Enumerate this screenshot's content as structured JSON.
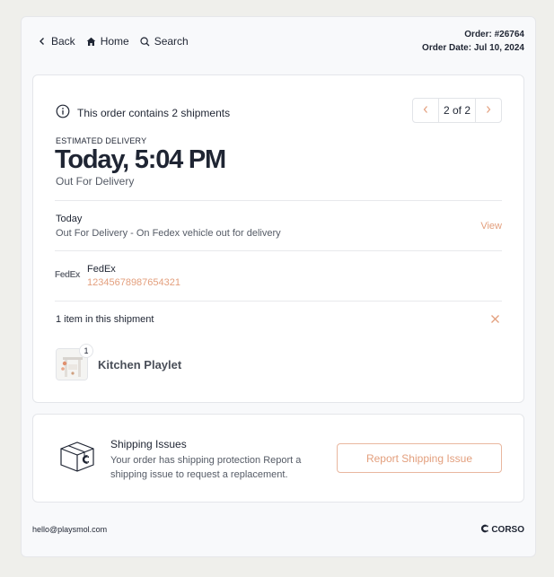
{
  "nav": {
    "back_label": "Back",
    "home_label": "Home",
    "search_label": "Search"
  },
  "order": {
    "number": "Order: #26764",
    "date": "Order Date: Jul 10, 2024"
  },
  "shipments": {
    "summary": "This order contains 2 shipments",
    "pager": "2 of 2"
  },
  "delivery": {
    "label": "ESTIMATED DELIVERY",
    "time": "Today, 5:04 PM",
    "status": "Out For Delivery"
  },
  "update": {
    "day": "Today",
    "text": "Out For Delivery - On Fedex vehicle out for delivery",
    "view_label": "View"
  },
  "carrier": {
    "logo_text": "FedEx",
    "name": "FedEx",
    "tracking": "12345678987654321"
  },
  "items": {
    "count_label": "1 item in this shipment",
    "list": [
      {
        "name": "Kitchen Playlet",
        "qty": "1"
      }
    ]
  },
  "issue": {
    "title": "Shipping Issues",
    "text": "Your order has shipping protection Report a shipping issue to request a replacement.",
    "button_label": "Report Shipping Issue"
  },
  "footer": {
    "email": "hello@playsmol.com",
    "brand": "CORSO"
  },
  "colors": {
    "accent": "#e39f7d",
    "text": "#1f2533",
    "muted": "#555b66",
    "background": "#efefeb"
  }
}
